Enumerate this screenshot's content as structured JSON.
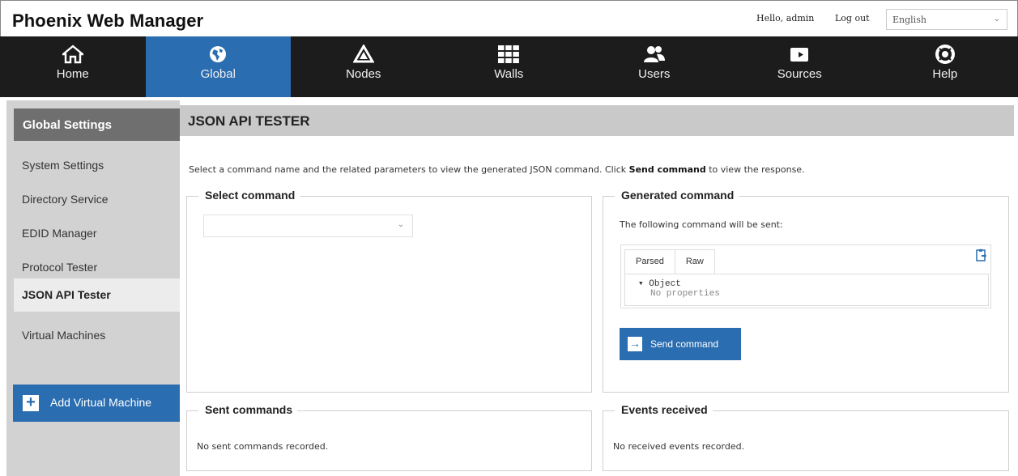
{
  "header": {
    "brand": "Phoenix Web Manager",
    "greeting": "Hello, admin",
    "logout": "Log out",
    "language": "English"
  },
  "nav": {
    "items": [
      {
        "label": "Home",
        "icon": "home-icon"
      },
      {
        "label": "Global",
        "icon": "globe-icon",
        "active": true
      },
      {
        "label": "Nodes",
        "icon": "nodes-icon"
      },
      {
        "label": "Walls",
        "icon": "grid-icon"
      },
      {
        "label": "Users",
        "icon": "users-icon"
      },
      {
        "label": "Sources",
        "icon": "camera-icon"
      },
      {
        "label": "Help",
        "icon": "lifebuoy-icon"
      }
    ]
  },
  "sidebar": {
    "title": "Global Settings",
    "items": [
      {
        "label": "System Settings"
      },
      {
        "label": "Directory Service"
      },
      {
        "label": "EDID Manager"
      },
      {
        "label": "Protocol Tester"
      },
      {
        "label": "JSON API Tester",
        "active": true
      },
      {
        "label": "Virtual Machines"
      }
    ],
    "add_button": "Add Virtual Machine"
  },
  "main": {
    "title": "JSON API TESTER",
    "intro_prefix": "Select a command name and the related parameters to view the generated JSON command. Click ",
    "intro_bold": "Send command",
    "intro_suffix": " to view the response.",
    "select_command": {
      "legend": "Select command",
      "value": ""
    },
    "generated": {
      "legend": "Generated command",
      "text": "The following command will be sent:",
      "tabs": [
        "Parsed",
        "Raw"
      ],
      "tree_root": "▾ Object",
      "tree_empty": "No properties",
      "send_label": "Send command"
    },
    "sent": {
      "legend": "Sent commands",
      "empty": "No sent commands recorded."
    },
    "events": {
      "legend": "Events received",
      "empty": "No received events recorded."
    }
  },
  "colors": {
    "accent": "#2a6db0",
    "nav_bg": "#1c1c1c",
    "sidebar_bg": "#d2d2d2",
    "header_bar": "#c9c9c9"
  }
}
